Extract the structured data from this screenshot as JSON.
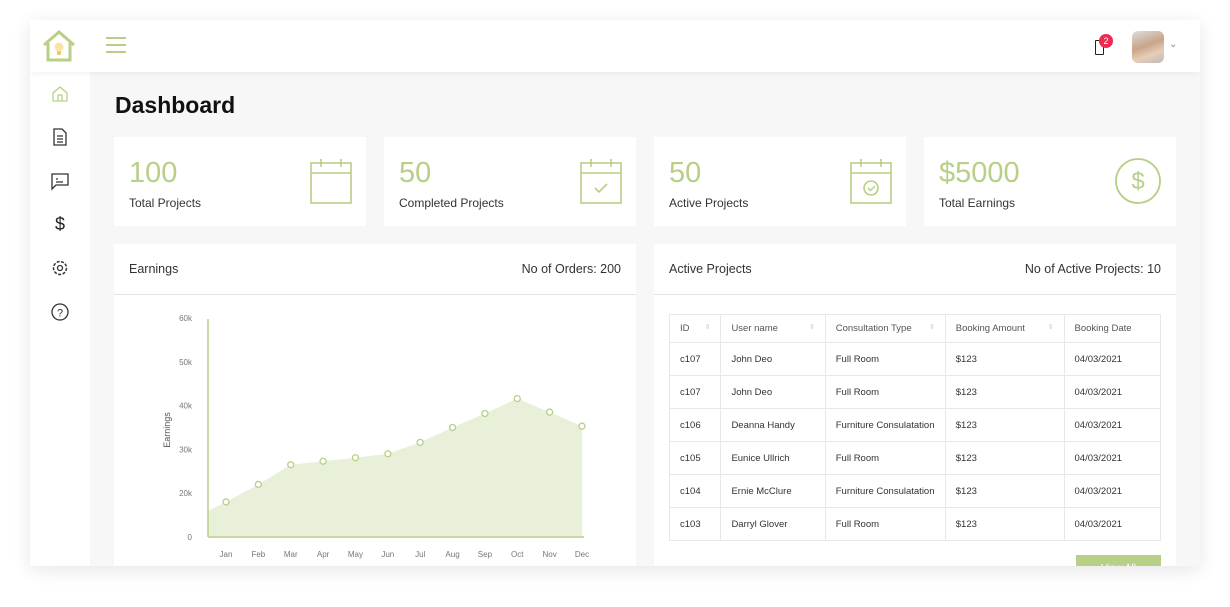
{
  "header": {
    "notification_count": "2"
  },
  "page_title": "Dashboard",
  "stats": [
    {
      "value": "100",
      "label": "Total Projects",
      "icon": "calendar-icon"
    },
    {
      "value": "50",
      "label": "Completed Projects",
      "icon": "calendar-check-icon"
    },
    {
      "value": "50",
      "label": "Active Projects",
      "icon": "calendar-clock-icon"
    },
    {
      "value": "$5000",
      "label": "Total Earnings",
      "icon": "dollar-circle-icon"
    }
  ],
  "earnings": {
    "title": "Earnings",
    "orders": "No of Orders: 200"
  },
  "chart_data": {
    "type": "area",
    "ylabel": "Earnings",
    "categories": [
      "Jan",
      "Feb",
      "Mar",
      "Apr",
      "May",
      "Jun",
      "Jul",
      "Aug",
      "Sep",
      "Oct",
      "Nov",
      "Dec"
    ],
    "values": [
      18000,
      22000,
      26500,
      27300,
      28100,
      29000,
      31600,
      35000,
      38200,
      41600,
      38500,
      35300
    ],
    "ytick_labels": [
      "0",
      "20k",
      "30k",
      "40k",
      "50k",
      "60k"
    ],
    "color": "#b7cf86"
  },
  "active": {
    "title": "Active Projects",
    "count": "No of Active Projects: 10",
    "columns": [
      "ID",
      "User name",
      "Consultation Type",
      "Booking Amount",
      "Booking Date"
    ],
    "rows": [
      [
        "c107",
        "John Deo",
        "Full Room",
        "$123",
        "04/03/2021"
      ],
      [
        "c107",
        "John Deo",
        "Full Room",
        "$123",
        "04/03/2021"
      ],
      [
        "c106",
        "Deanna Handy",
        "Furniture Consulatation",
        "$123",
        "04/03/2021"
      ],
      [
        "c105",
        "Eunice Ullrich",
        "Full Room",
        "$123",
        "04/03/2021"
      ],
      [
        "c104",
        "Ernie McClure",
        "Furniture Consulatation",
        "$123",
        "04/03/2021"
      ],
      [
        "c103",
        "Darryl Glover",
        "Full Room",
        "$123",
        "04/03/2021"
      ]
    ],
    "view_all": "View All"
  },
  "colors": {
    "accent": "#b7cf86",
    "badge": "#f0294f"
  }
}
